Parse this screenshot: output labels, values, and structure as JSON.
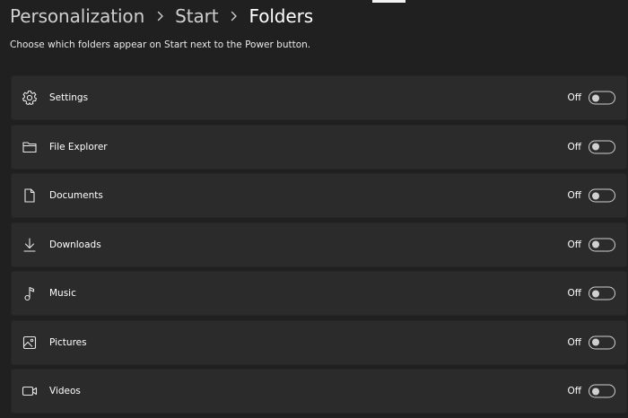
{
  "breadcrumb": {
    "items": [
      {
        "label": "Personalization"
      },
      {
        "label": "Start"
      },
      {
        "label": "Folders"
      }
    ]
  },
  "description": "Choose which folders appear on Start next to the Power button.",
  "folders": [
    {
      "label": "Settings",
      "icon": "gear-icon",
      "state": "Off",
      "on": false
    },
    {
      "label": "File Explorer",
      "icon": "folder-icon",
      "state": "Off",
      "on": false
    },
    {
      "label": "Documents",
      "icon": "document-icon",
      "state": "Off",
      "on": false
    },
    {
      "label": "Downloads",
      "icon": "download-icon",
      "state": "Off",
      "on": false
    },
    {
      "label": "Music",
      "icon": "music-note-icon",
      "state": "Off",
      "on": false
    },
    {
      "label": "Pictures",
      "icon": "picture-icon",
      "state": "Off",
      "on": false
    },
    {
      "label": "Videos",
      "icon": "video-camera-icon",
      "state": "Off",
      "on": false
    }
  ],
  "colors": {
    "background": "#202020",
    "card": "#2b2b2b",
    "text": "#ffffff",
    "toggle_off_border": "#cfcfcf"
  }
}
